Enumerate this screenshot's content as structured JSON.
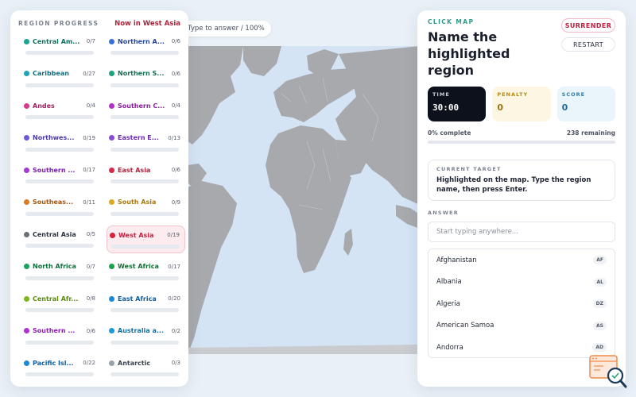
{
  "map": {
    "hint": "Type to answer / 100%"
  },
  "region_progress": {
    "title": "REGION PROGRESS",
    "now_in": "Now in West Asia",
    "regions": [
      {
        "name": "Central Am...",
        "count": "0/7",
        "color": "#1aa38f",
        "text_color": "#0f6f60"
      },
      {
        "name": "Northern A...",
        "count": "0/6",
        "color": "#3a6fd8",
        "text_color": "#2346a3"
      },
      {
        "name": "Caribbean",
        "count": "0/27",
        "color": "#1ea3b8",
        "text_color": "#0f6f80"
      },
      {
        "name": "Northern S...",
        "count": "0/6",
        "color": "#1aa37a",
        "text_color": "#0f6f50"
      },
      {
        "name": "Andes",
        "count": "0/4",
        "color": "#d63a8a",
        "text_color": "#a3205e"
      },
      {
        "name": "Southern C...",
        "count": "0/4",
        "color": "#b033c8",
        "text_color": "#8a1fa0"
      },
      {
        "name": "Northwes...",
        "count": "0/19",
        "color": "#6a5ad8",
        "text_color": "#4a3aa8"
      },
      {
        "name": "Eastern E...",
        "count": "0/13",
        "color": "#8a4ad8",
        "text_color": "#6a2ab0"
      },
      {
        "name": "Southern ...",
        "count": "0/17",
        "color": "#a33ad8",
        "text_color": "#7a1fb0"
      },
      {
        "name": "East Asia",
        "count": "0/6",
        "color": "#d62a4a",
        "text_color": "#b01f3a"
      },
      {
        "name": "Southeas...",
        "count": "0/11",
        "color": "#e07a1f",
        "text_color": "#a8560f"
      },
      {
        "name": "South Asia",
        "count": "0/9",
        "color": "#e0a81f",
        "text_color": "#a8780f"
      },
      {
        "name": "Central Asia",
        "count": "0/5",
        "color": "#6a6f78",
        "text_color": "#2b3140"
      },
      {
        "name": "West Asia",
        "count": "0/19",
        "color": "#d6203f",
        "text_color": "#c0213f",
        "active": true
      },
      {
        "name": "North Africa",
        "count": "0/7",
        "color": "#1aa35a",
        "text_color": "#0f6f3a"
      },
      {
        "name": "West Africa",
        "count": "0/17",
        "color": "#1aa34a",
        "text_color": "#0f6f30"
      },
      {
        "name": "Central Afr...",
        "count": "0/8",
        "color": "#7ab81f",
        "text_color": "#5a8a0f"
      },
      {
        "name": "East Africa",
        "count": "0/20",
        "color": "#1a8ad8",
        "text_color": "#0f5fa0"
      },
      {
        "name": "Southern ...",
        "count": "0/6",
        "color": "#b033d8",
        "text_color": "#8a1fb0"
      },
      {
        "name": "Australia a...",
        "count": "0/2",
        "color": "#1a9ad8",
        "text_color": "#0f6fa0"
      },
      {
        "name": "Pacific Isl...",
        "count": "0/22",
        "color": "#1a8ad8",
        "text_color": "#0f5fa0"
      },
      {
        "name": "Antarctic",
        "count": "0/3",
        "color": "#9aa0aa",
        "text_color": "#3a404c"
      }
    ]
  },
  "quiz": {
    "kicker": "CLICK MAP",
    "title": "Name the highlighted region",
    "surrender_label": "SURRENDER",
    "restart_label": "RESTART",
    "stats": {
      "time_label": "TIME",
      "time_value": "30:00",
      "penalty_label": "PENALTY",
      "penalty_value": "0",
      "score_label": "SCORE",
      "score_value": "0"
    },
    "progress_left": "0% complete",
    "progress_right": "238 remaining",
    "progress_fraction": 0,
    "target_kicker": "CURRENT TARGET",
    "target_text": "Highlighted on the map. Type the region name, then press Enter.",
    "answer_label": "ANSWER",
    "answer_placeholder": "Start typing anywhere...",
    "answer_value": "",
    "suggestions": [
      {
        "name": "Afghanistan",
        "code": "AF"
      },
      {
        "name": "Albania",
        "code": "AL"
      },
      {
        "name": "Algeria",
        "code": "DZ"
      },
      {
        "name": "American Samoa",
        "code": "AS"
      },
      {
        "name": "Andorra",
        "code": "AD"
      }
    ]
  },
  "colors": {
    "accent_red": "#c0213f",
    "accent_teal": "#2e9a8c",
    "land": "#a7a9ad",
    "ocean": "#d4e4f4"
  }
}
